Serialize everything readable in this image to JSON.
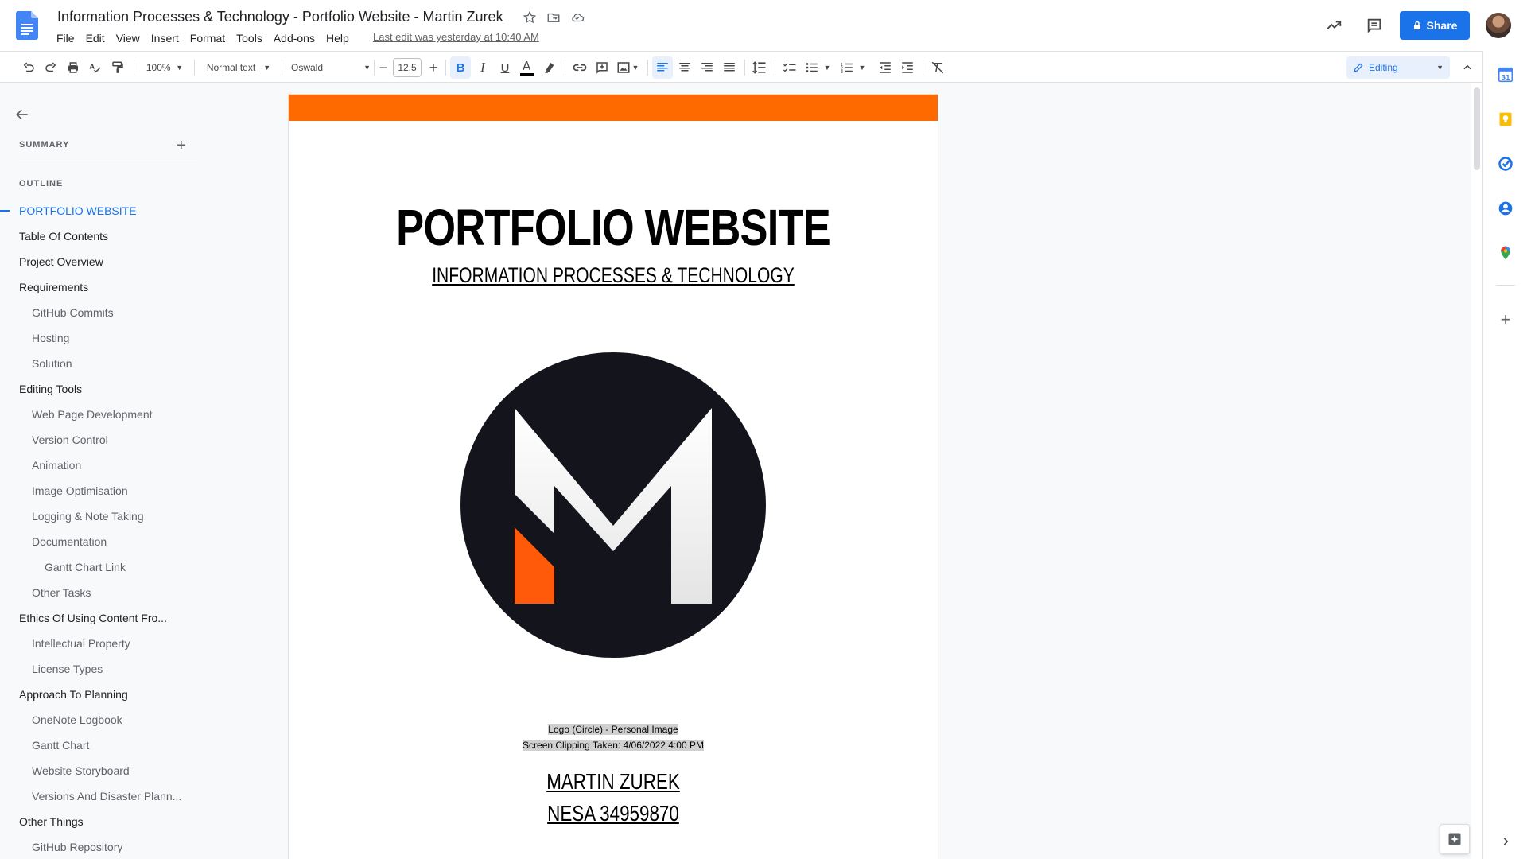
{
  "app": {
    "doc_title": "Information Processes & Technology - Portfolio Website - Martin Zurek",
    "last_edit": "Last edit was yesterday at 10:40 AM",
    "share_label": "Share",
    "accent_color": "#1a73e8"
  },
  "menu": [
    "File",
    "Edit",
    "View",
    "Insert",
    "Format",
    "Tools",
    "Add-ons",
    "Help"
  ],
  "toolbar": {
    "zoom": "100%",
    "style": "Normal text",
    "font": "Oswald",
    "font_size": "12.5",
    "mode": "Editing"
  },
  "outline": {
    "summary_label": "SUMMARY",
    "outline_label": "OUTLINE",
    "items": [
      {
        "text": "PORTFOLIO WEBSITE",
        "level": 1
      },
      {
        "text": "Table Of Contents",
        "level": 1
      },
      {
        "text": "Project Overview",
        "level": 1
      },
      {
        "text": "Requirements",
        "level": 1
      },
      {
        "text": "GitHub Commits",
        "level": 2
      },
      {
        "text": "Hosting",
        "level": 2
      },
      {
        "text": "Solution",
        "level": 2
      },
      {
        "text": "Editing Tools",
        "level": 1
      },
      {
        "text": "Web Page Development",
        "level": 2
      },
      {
        "text": "Version Control",
        "level": 2
      },
      {
        "text": "Animation",
        "level": 2
      },
      {
        "text": "Image Optimisation",
        "level": 2
      },
      {
        "text": "Logging & Note Taking",
        "level": 2
      },
      {
        "text": "Documentation",
        "level": 2
      },
      {
        "text": "Gantt Chart Link",
        "level": 3
      },
      {
        "text": "Other Tasks",
        "level": 2
      },
      {
        "text": "Ethics Of Using Content Fro...",
        "level": 1
      },
      {
        "text": "Intellectual Property",
        "level": 2
      },
      {
        "text": "License Types",
        "level": 2
      },
      {
        "text": "Approach To Planning",
        "level": 1
      },
      {
        "text": "OneNote Logbook",
        "level": 2
      },
      {
        "text": "Gantt Chart",
        "level": 2
      },
      {
        "text": "Website Storyboard",
        "level": 2
      },
      {
        "text": "Versions And Disaster Plann...",
        "level": 2
      },
      {
        "text": "Other Things",
        "level": 1
      },
      {
        "text": "GitHub Repository",
        "level": 2
      }
    ]
  },
  "document": {
    "title": "PORTFOLIO WEBSITE",
    "subtitle": "INFORMATION PROCESSES & TECHNOLOGY",
    "caption_line1": "Logo (Circle) - Personal Image",
    "caption_line2": "Screen Clipping Taken: 4/06/2022 4:00 PM",
    "author": "MARTIN ZUREK",
    "nesa": "NESA 34959870",
    "band_color": "#ff6a00"
  }
}
